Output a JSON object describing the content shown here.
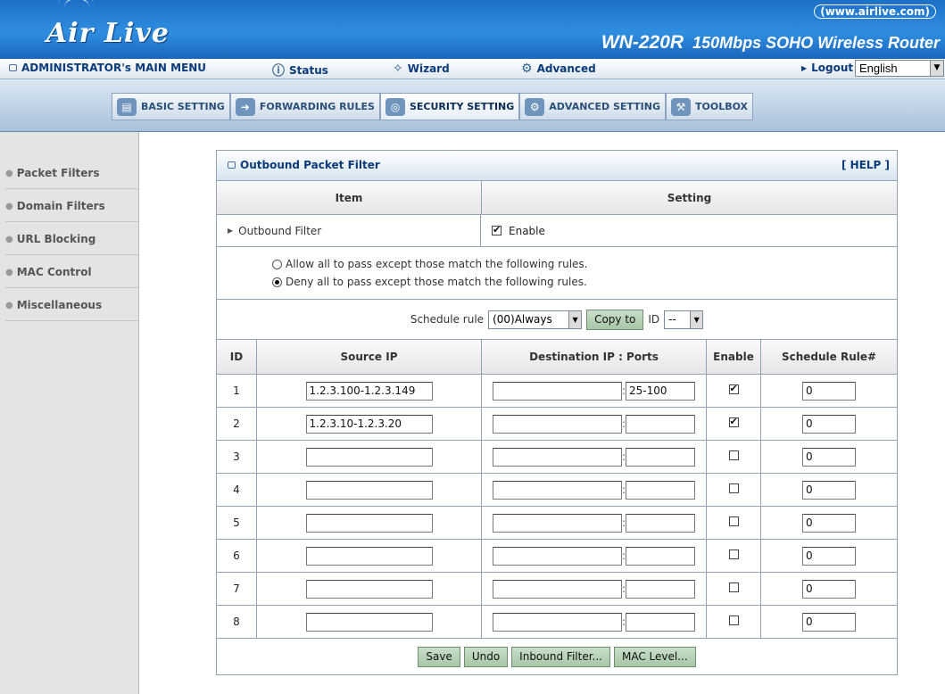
{
  "header": {
    "logo": "Air Live",
    "website": "(www.airlive.com)",
    "model": "WN-220R",
    "product": "150Mbps SOHO Wireless Router"
  },
  "mainmenu": {
    "admin": "ADMINISTRATOR's MAIN MENU",
    "status": "Status",
    "wizard": "Wizard",
    "advanced": "Advanced",
    "logout": "Logout",
    "language": "English"
  },
  "tabs": [
    {
      "label": "BASIC SETTING",
      "icon": "folder-icon"
    },
    {
      "label": "FORWARDING RULES",
      "icon": "forward-icon"
    },
    {
      "label": "SECURITY SETTING",
      "icon": "lock-icon"
    },
    {
      "label": "ADVANCED SETTING",
      "icon": "advanced-icon"
    },
    {
      "label": "TOOLBOX",
      "icon": "toolbox-icon"
    }
  ],
  "sidebar": {
    "items": [
      {
        "label": "Packet Filters"
      },
      {
        "label": "Domain Filters"
      },
      {
        "label": "URL Blocking"
      },
      {
        "label": "MAC Control"
      },
      {
        "label": "Miscellaneous"
      }
    ]
  },
  "panel": {
    "title": "Outbound Packet Filter",
    "help": "[ HELP ]",
    "col_item": "Item",
    "col_setting": "Setting",
    "outbound_label": "Outbound Filter",
    "enable_label": "Enable",
    "enable_checked": true,
    "radio_allow": "Allow all to pass except those match the following rules.",
    "radio_deny": "Deny all to pass except those match the following rules.",
    "radio_selected": "deny",
    "schedule_label": "Schedule rule",
    "schedule_value": "(00)Always",
    "copy_to": "Copy to",
    "id_label": "ID",
    "id_value": "--"
  },
  "rules_table": {
    "headers": [
      "ID",
      "Source IP",
      "Destination IP : Ports",
      "Enable",
      "Schedule Rule#"
    ],
    "rows": [
      {
        "id": "1",
        "source": "1.2.3.100-1.2.3.149",
        "dest": "",
        "ports": "25-100",
        "enabled": true,
        "schedule": "0"
      },
      {
        "id": "2",
        "source": "1.2.3.10-1.2.3.20",
        "dest": "",
        "ports": "",
        "enabled": true,
        "schedule": "0"
      },
      {
        "id": "3",
        "source": "",
        "dest": "",
        "ports": "",
        "enabled": false,
        "schedule": "0"
      },
      {
        "id": "4",
        "source": "",
        "dest": "",
        "ports": "",
        "enabled": false,
        "schedule": "0"
      },
      {
        "id": "5",
        "source": "",
        "dest": "",
        "ports": "",
        "enabled": false,
        "schedule": "0"
      },
      {
        "id": "6",
        "source": "",
        "dest": "",
        "ports": "",
        "enabled": false,
        "schedule": "0"
      },
      {
        "id": "7",
        "source": "",
        "dest": "",
        "ports": "",
        "enabled": false,
        "schedule": "0"
      },
      {
        "id": "8",
        "source": "",
        "dest": "",
        "ports": "",
        "enabled": false,
        "schedule": "0"
      }
    ]
  },
  "buttons": {
    "save": "Save",
    "undo": "Undo",
    "inbound": "Inbound Filter...",
    "mac": "MAC Level..."
  }
}
